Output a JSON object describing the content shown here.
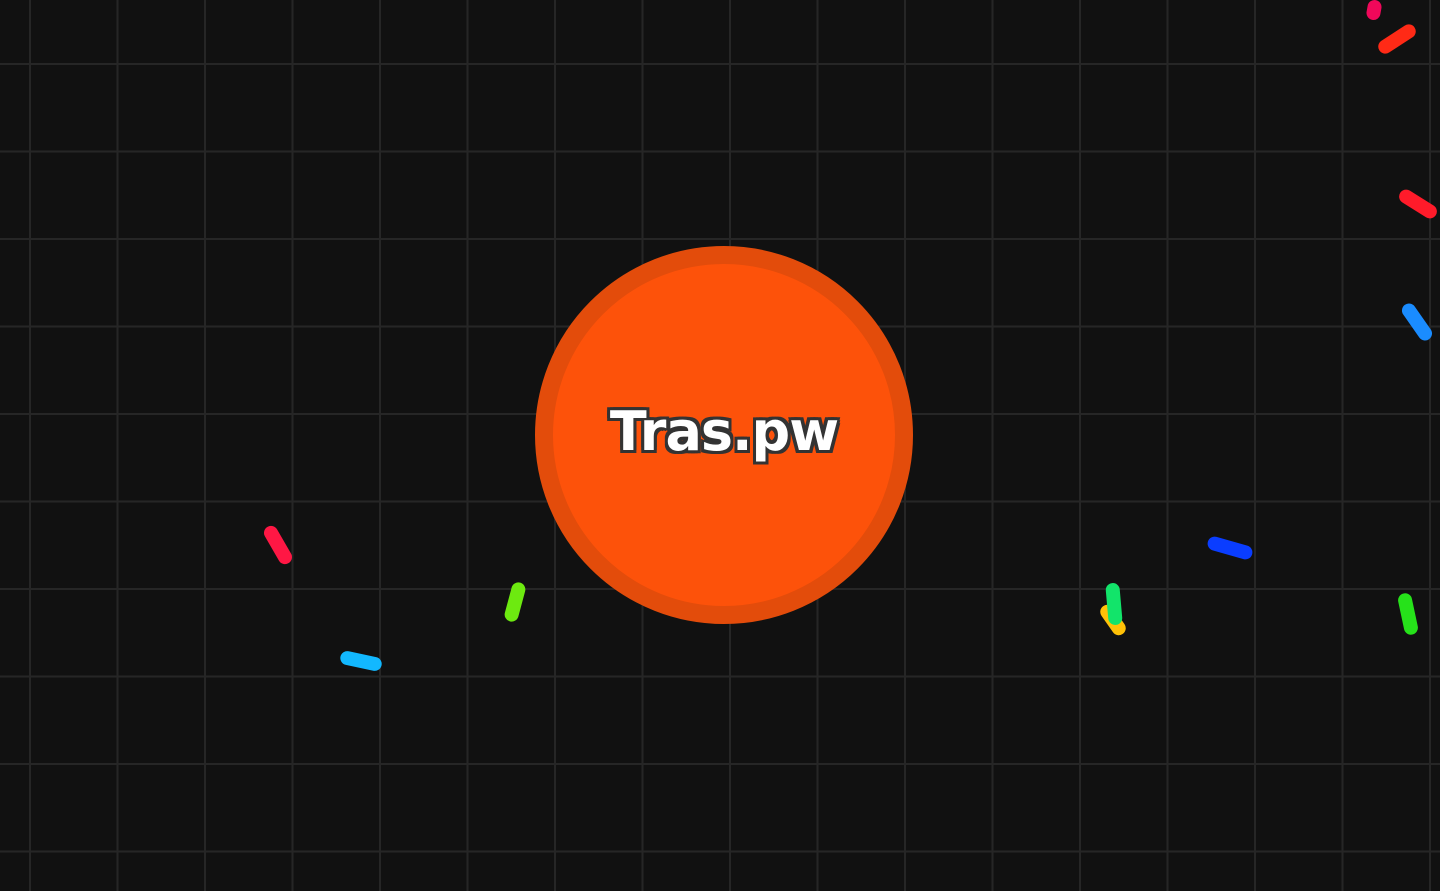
{
  "player": {
    "name": "Tras.pw",
    "color": "#fd520a",
    "border_color": "#e34c0b"
  },
  "board": {
    "background_color": "#111111",
    "grid_color": "#262626",
    "grid": true
  },
  "food_colors": [
    "#f0085a",
    "#ff2a16",
    "#ff1b2a",
    "#1a8cff",
    "#ff1744",
    "#12b8ff",
    "#6dea10",
    "#ffc107",
    "#12e46a",
    "#0a3dff",
    "#26e21a"
  ]
}
